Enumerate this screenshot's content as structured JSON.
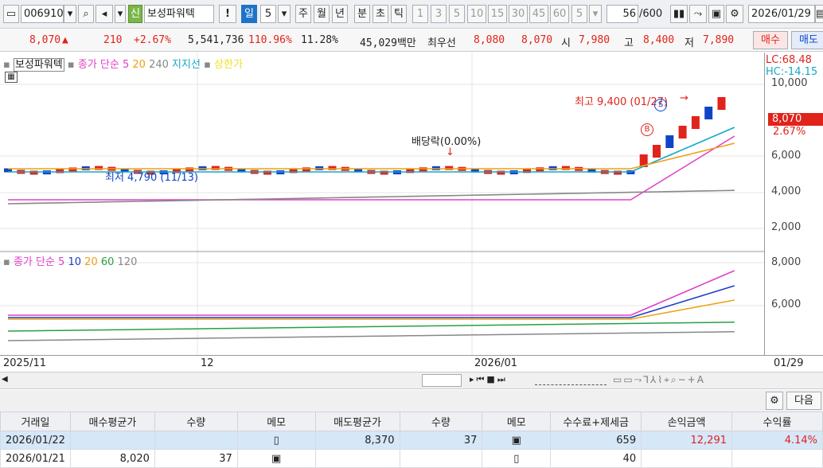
{
  "toolbar": {
    "code": "006910",
    "credit_badge": "신",
    "stock_name": "보성파워텍",
    "exclaim": "!",
    "period_selected": "일",
    "period_count": "5",
    "periods": [
      "주",
      "월",
      "년",
      "분",
      "초",
      "틱"
    ],
    "intervals": [
      "1",
      "3",
      "5",
      "10",
      "15",
      "30",
      "45",
      "60"
    ],
    "interval_select": "5",
    "data_count": "56",
    "data_total": "/600",
    "date": "2026/01/29"
  },
  "quote": {
    "price": "8,070",
    "arrow": "▲",
    "change": "210",
    "change_pct": "+2.67%",
    "volume": "5,541,736",
    "vol_ratio": "110.96%",
    "turnover": "11.28%",
    "amount": "45,029백만",
    "best_ask_label": "최우선",
    "best_ask": "8,080",
    "best_bid": "8,070",
    "open_label": "시",
    "open": "7,980",
    "high_label": "고",
    "high": "8,400",
    "low_label": "저",
    "low": "7,890",
    "buy_btn": "매수",
    "sell_btn": "매도"
  },
  "price_chart": {
    "name": "보성파워텍",
    "ma_label": "종가 단순 5",
    "ma20": "20",
    "ma240": "240",
    "support_label": "지지선",
    "limit_label": "상한가",
    "high_annot": "최고 9,400 (01/27)",
    "low_annot": "최저 4,790 (11/13)",
    "dividend_annot": "배당락(0.00%)",
    "lc": "LC:68.48",
    "hc": "HC:-14.15",
    "last_price": "8,070",
    "last_pct": "2.67%",
    "y_ticks": [
      "10,000",
      "6,000",
      "4,000",
      "2,000"
    ],
    "badge_b": "B",
    "badge_s": "S"
  },
  "ma_chart": {
    "label": "종가 단순 5",
    "p10": "10",
    "p20": "20",
    "p60": "60",
    "p120": "120",
    "y_ticks": [
      "8,000",
      "6,000"
    ]
  },
  "x_axis": {
    "labels": [
      "2025/11",
      "12",
      "2026/01"
    ],
    "right": "01/29"
  },
  "panel": {
    "next_btn": "다음"
  },
  "table": {
    "headers": [
      "거래일",
      "매수평균가",
      "수량",
      "메모",
      "매도평균가",
      "수량",
      "메모",
      "수수료+제세금",
      "손익금액",
      "수익률"
    ],
    "rows": [
      [
        "2026/01/22",
        "",
        "",
        "",
        "8,370",
        "37",
        "",
        "659",
        "12,291",
        "4.14%"
      ],
      [
        "2026/01/21",
        "8,020",
        "37",
        "",
        "",
        "",
        "",
        "40",
        "",
        ""
      ]
    ]
  },
  "colors": {
    "up": "#e0231b",
    "down": "#1044c8",
    "ma5": "#e040c8",
    "ma10": "#1e3cc8",
    "ma20": "#f0a010",
    "ma60": "#28a040",
    "ma240": "#888888",
    "support": "#16a7c8"
  }
}
